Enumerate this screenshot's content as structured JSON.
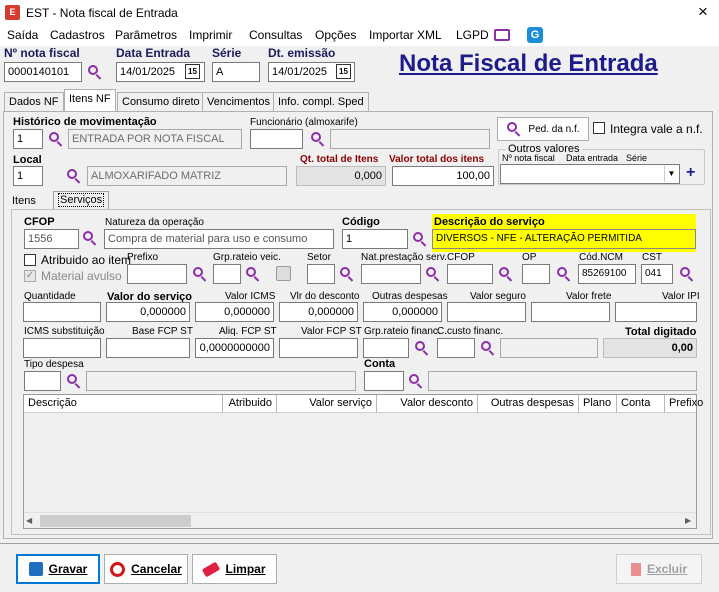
{
  "window": {
    "title": "EST - Nota fiscal de Entrada",
    "close_icon": "×"
  },
  "menu": [
    "Saída",
    "Cadastros",
    "Parâmetros",
    "Imprimir",
    "Consultas",
    "Opções",
    "Importar XML",
    "LGPD"
  ],
  "header": {
    "nota_label": "Nº nota fiscal",
    "nota_value": "0000140101",
    "data_entrada_label": "Data Entrada",
    "data_entrada_value": "14/01/2025",
    "serie_label": "Série",
    "serie_value": "A",
    "dt_emissao_label": "Dt. emissão",
    "dt_emissao_value": "14/01/2025",
    "big_title": "Nota Fiscal de Entrada",
    "cal_glyph": "15"
  },
  "tabs": [
    "Dados NF",
    "Itens NF",
    "Consumo direto",
    "Vencimentos",
    "Info. compl. Sped"
  ],
  "itens_nf": {
    "historico_label": "Histórico de movimentação",
    "historico_code": "1",
    "historico_desc": "ENTRADA POR NOTA FISCAL",
    "funcionario_label": "Funcionário (almoxarife)",
    "funcionario_code": "",
    "funcionario_desc": "",
    "ped_nf_button": "Ped. da n.f.",
    "integra_label": "Integra vale a n.f.",
    "local_label": "Local",
    "local_code": "1",
    "local_desc": "ALMOXARIFADO MATRIZ",
    "qt_total_label": "Qt. total de Itens",
    "qt_total_value": "0,000",
    "valor_total_label": "Valor total dos itens",
    "valor_total_value": "100,00",
    "outros_valores_label": "Outros valores",
    "outros_cols": [
      "Nº nota fiscal",
      "Data entrada",
      "Série"
    ],
    "add_glyph": "+"
  },
  "subtabs": [
    "Itens",
    "Serviços"
  ],
  "servicos": {
    "cfop_label": "CFOP",
    "cfop_value": "1556",
    "natureza_label": "Natureza da operação",
    "natureza_value": "Compra de material para uso e consumo",
    "codigo_label": "Código",
    "codigo_value": "1",
    "descricao_label": "Descrição do serviço",
    "descricao_value": "DIVERSOS - NFE - ALTERAÇÃO PERMITIDA",
    "atribuido_label": "Atribuido ao item",
    "material_label": "Material avulso",
    "prefixo_label": "Prefixo",
    "grp_rateio_veic_label": "Grp.rateio veic.",
    "setor_label": "Setor",
    "nat_prest_label": "Nat.prestação serv.",
    "cfop2_label": "CFOP",
    "op_label": "OP",
    "cod_ncm_label": "Cód.NCM",
    "cod_ncm_value": "85269100",
    "cst_label": "CST",
    "cst_value": "041",
    "quantidade_label": "Quantidade",
    "valor_servico_label": "Valor do serviço",
    "valor_servico_value": "0,000000",
    "valor_icms_label": "Valor ICMS",
    "valor_icms_value": "0,000000",
    "vlr_desconto_label": "Vlr do desconto",
    "vlr_desconto_value": "0,000000",
    "outras_despesas_label": "Outras despesas",
    "outras_despesas_value": "0,000000",
    "valor_seguro_label": "Valor seguro",
    "valor_frete_label": "Valor frete",
    "valor_ipi_label": "Valor IPI",
    "icms_sub_label": "ICMS substituição",
    "base_fcp_label": "Base FCP ST",
    "aliq_fcp_label": "Aliq. FCP ST",
    "aliq_fcp_value": "0,0000000000",
    "valor_fcp_label": "Valor FCP ST",
    "grp_rateio_fin_label": "Grp.rateio financ.",
    "c_custo_label": "C.custo financ.",
    "total_digitado_label": "Total digitado",
    "total_digitado_value": "0,00",
    "tipo_despesa_label": "Tipo despesa",
    "conta_label": "Conta"
  },
  "grid_columns": [
    "Descrição",
    "Atribuido",
    "Valor serviço",
    "Valor desconto",
    "Outras despesas",
    "Plano",
    "Conta",
    "Prefixo"
  ],
  "buttons": {
    "gravar": "Gravar",
    "cancelar": "Cancelar",
    "limpar": "Limpar",
    "excluir": "Excluir"
  },
  "colors": {
    "accent": "#8c2ea8",
    "label_navy": "#1c1c5c",
    "label_red": "#8b0000",
    "highlight": "#ffff00"
  }
}
